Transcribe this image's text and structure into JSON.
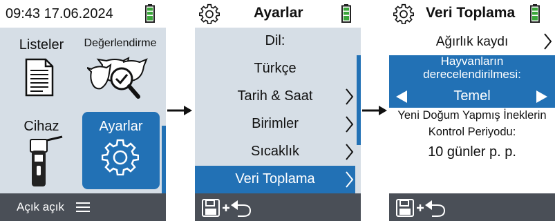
{
  "screen1": {
    "clock": "09:43 17.06.2024",
    "tiles": [
      {
        "label": "Listeler",
        "icon": "document-icon"
      },
      {
        "label": "Değerlendirme",
        "icon": "cattle-evaluation-icon"
      },
      {
        "label": "Cihaz",
        "icon": "handheld-device-icon"
      },
      {
        "label": "Ayarlar",
        "icon": "gear-icon"
      }
    ],
    "selected_tile": "Ayarlar",
    "footer_label": "Açık açık",
    "footer_icon": "menu-icon"
  },
  "screen2": {
    "title": "Ayarlar",
    "title_icon": "gear-icon",
    "items": [
      {
        "label": "Dil:",
        "chevron": false
      },
      {
        "label": "Türkçe",
        "chevron": false
      },
      {
        "label": "Tarih & Saat",
        "chevron": true
      },
      {
        "label": "Birimler",
        "chevron": true
      },
      {
        "label": "Sıcaklık",
        "chevron": true
      },
      {
        "label": "Veri Toplama",
        "chevron": true
      }
    ],
    "selected_item": "Veri Toplama",
    "footer_icon": "save-and-back-icon"
  },
  "screen3": {
    "title": "Veri Toplama",
    "title_icon": "gear-icon",
    "weight_record_label": "Ağırlık kaydı",
    "selector_title_line1": "Hayvanların",
    "selector_title_line2": "derecelendirilmesi:",
    "selector_value": "Temel",
    "period_line1": "Yeni Doğum Yapmış İneklerin",
    "period_line2": "Kontrol Periyodu:",
    "period_value": "10 günler p. p.",
    "footer_icon": "save-and-back-icon"
  },
  "colors": {
    "accent": "#2271b5",
    "panel": "#d6dee6",
    "footer": "#4a4f57",
    "battery": "#3aa63a"
  }
}
